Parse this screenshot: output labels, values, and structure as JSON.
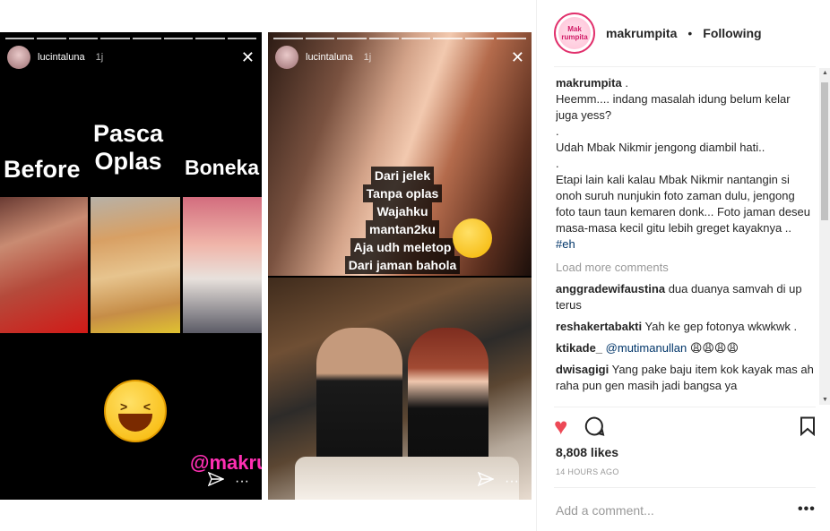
{
  "story_left": {
    "username": "lucintaluna",
    "age": "1j",
    "titles": {
      "pasca": "Pasca\nOplas",
      "before": "Before",
      "boneka": "Boneka"
    },
    "watermark": "@makrumpita"
  },
  "story_right": {
    "username": "lucintaluna",
    "age": "1j",
    "overlay_lines": [
      "Dari jelek",
      "Tanpa oplas",
      "Wajahku",
      "mantan2ku",
      "Aja udh meletop",
      "Dari jaman bahola"
    ]
  },
  "header": {
    "username": "makrumpita",
    "separator": "•",
    "follow_status": "Following",
    "avatar_text": "Mak rumpita"
  },
  "caption": {
    "username": "makrumpita",
    "lines": [
      "Heemm.... indang masalah idung belum kelar juga yess?",
      ".",
      "Udah Mbak Nikmir jengong diambil hati..",
      ".",
      "Etapi lain kali kalau Mbak Nikmir nantangin si onoh suruh nunjukin foto zaman dulu, jengong foto taun taun kemaren donk... Foto jaman deseu masa-masa kecil gitu lebih greget kayaknya .."
    ],
    "hashtag": "#eh"
  },
  "load_more": "Load more comments",
  "comments": [
    {
      "user": "anggradewifaustina",
      "text": "dua duanya samvah di up terus"
    },
    {
      "user": "reshakertabakti",
      "text": "Yah ke gep fotonya wkwkwk ."
    },
    {
      "user": "ktikade_",
      "mention": "@mutimanullan",
      "text": "😩😩😩😩"
    },
    {
      "user": "dwisagigi",
      "text": "Yang pake baju item kok kayak mas ah raha pun gen masih jadi bangsa ya"
    }
  ],
  "likes": "8,808 likes",
  "time": "14 HOURS AGO",
  "add_comment_placeholder": "Add a comment...",
  "more": "•••",
  "colors": {
    "heart": "#ed4956",
    "link": "#003569",
    "muted": "#999999",
    "watermark": "#ff2fb3"
  }
}
